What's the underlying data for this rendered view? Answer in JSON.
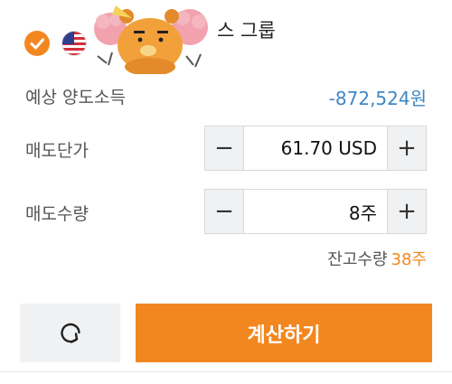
{
  "header": {
    "group_name": "스 그룹",
    "check_icon": "checkmark-circle-icon",
    "flag_icon": "us-flag-icon",
    "accent": "#f3871f"
  },
  "estimated_income": {
    "label": "예상 양도소득",
    "value": "-872,524원",
    "value_color": "#3f87c6"
  },
  "sell_price": {
    "label": "매도단가",
    "value": "61.70 USD",
    "minus": "−",
    "plus": "+"
  },
  "sell_quantity": {
    "label": "매도수량",
    "value": "8주",
    "minus": "−",
    "plus": "+"
  },
  "holdings": {
    "label": "잔고수량",
    "value": "38주"
  },
  "actions": {
    "reset_icon": "refresh-icon",
    "calculate_label": "계산하기"
  }
}
